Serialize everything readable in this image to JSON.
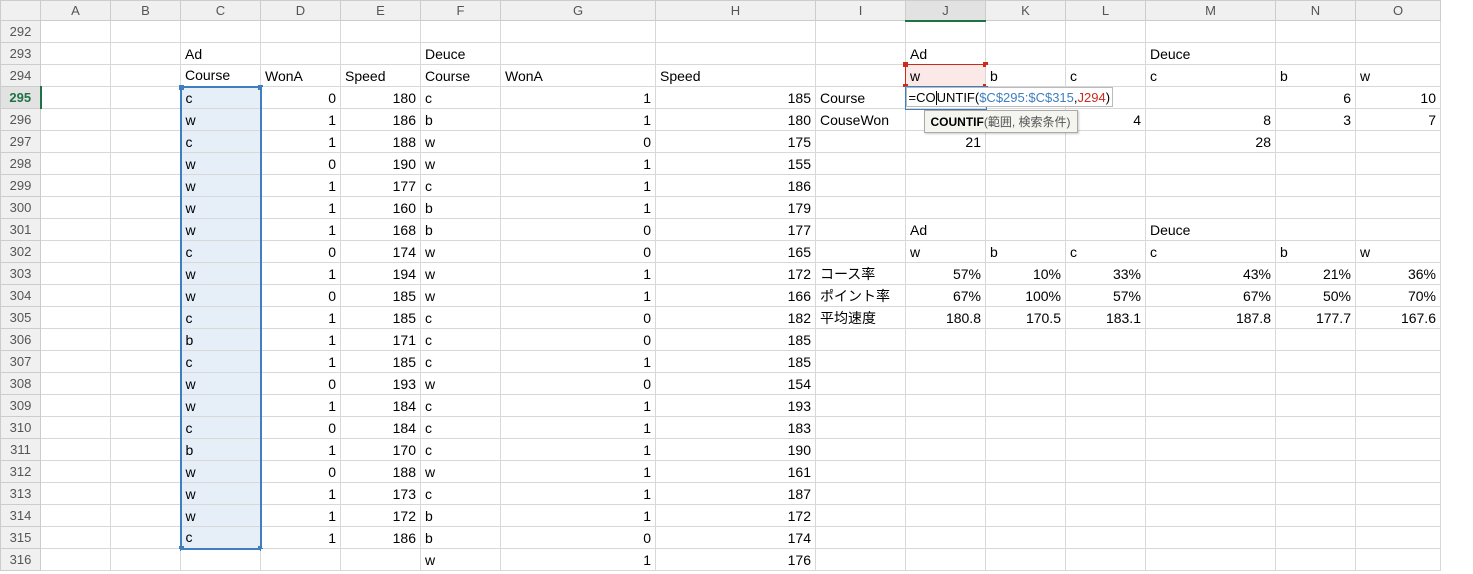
{
  "columns": [
    "A",
    "B",
    "C",
    "D",
    "E",
    "F",
    "G",
    "H",
    "I",
    "J",
    "K",
    "L",
    "M",
    "N",
    "O"
  ],
  "rows": [
    292,
    293,
    294,
    295,
    296,
    297,
    298,
    299,
    300,
    301,
    302,
    303,
    304,
    305,
    306,
    307,
    308,
    309,
    310,
    311,
    312,
    313,
    314,
    315,
    316
  ],
  "active_row": 295,
  "active_col": "J",
  "selected_range": {
    "col": "C",
    "from": 295,
    "to": 315
  },
  "ref_red_cell": {
    "col": "J",
    "row": 294
  },
  "formula_text": "=COUNTIF($C$295:$C$315,J294)",
  "formula_parts": {
    "prefix": "=CO",
    "mid1": "U",
    "mid2": "NTIF(",
    "range": "$C$295:$C$315",
    "comma": ",",
    "ref": "J294",
    "close": ")"
  },
  "tooltip_fn": "COUNTIF",
  "tooltip_args": "(範囲, 検索条件)",
  "cells": {
    "293": {
      "C": {
        "t": "Ad"
      },
      "F": {
        "t": "Deuce"
      },
      "J": {
        "t": "Ad"
      },
      "M": {
        "t": "Deuce"
      }
    },
    "294": {
      "C": {
        "t": "Course"
      },
      "D": {
        "t": "WonA"
      },
      "E": {
        "t": "Speed"
      },
      "F": {
        "t": "Course"
      },
      "G": {
        "t": "WonA"
      },
      "H": {
        "t": "Speed"
      },
      "J": {
        "t": "w"
      },
      "K": {
        "t": "b"
      },
      "L": {
        "t": "c"
      },
      "M": {
        "t": "c"
      },
      "N": {
        "t": "b"
      },
      "O": {
        "t": "w"
      }
    },
    "295": {
      "C": {
        "t": "c"
      },
      "D": {
        "n": "0"
      },
      "E": {
        "n": "180"
      },
      "F": {
        "t": "c"
      },
      "G": {
        "n": "1"
      },
      "H": {
        "n": "185"
      },
      "I": {
        "t": "Course"
      },
      "N": {
        "n": "6"
      },
      "O": {
        "n": "10"
      }
    },
    "296": {
      "C": {
        "t": "w"
      },
      "D": {
        "n": "1"
      },
      "E": {
        "n": "186"
      },
      "F": {
        "t": "b"
      },
      "G": {
        "n": "1"
      },
      "H": {
        "n": "180"
      },
      "I": {
        "t": "CouseWon"
      },
      "L": {
        "n": "4"
      },
      "M": {
        "n": "8"
      },
      "N": {
        "n": "3"
      },
      "O": {
        "n": "7"
      }
    },
    "297": {
      "C": {
        "t": "c"
      },
      "D": {
        "n": "1"
      },
      "E": {
        "n": "188"
      },
      "F": {
        "t": "w"
      },
      "G": {
        "n": "0"
      },
      "H": {
        "n": "175"
      },
      "J": {
        "n": "21"
      },
      "M": {
        "n": "28"
      }
    },
    "298": {
      "C": {
        "t": "w"
      },
      "D": {
        "n": "0"
      },
      "E": {
        "n": "190"
      },
      "F": {
        "t": "w"
      },
      "G": {
        "n": "1"
      },
      "H": {
        "n": "155"
      }
    },
    "299": {
      "C": {
        "t": "w"
      },
      "D": {
        "n": "1"
      },
      "E": {
        "n": "177"
      },
      "F": {
        "t": "c"
      },
      "G": {
        "n": "1"
      },
      "H": {
        "n": "186"
      }
    },
    "300": {
      "C": {
        "t": "w"
      },
      "D": {
        "n": "1"
      },
      "E": {
        "n": "160"
      },
      "F": {
        "t": "b"
      },
      "G": {
        "n": "1"
      },
      "H": {
        "n": "179"
      }
    },
    "301": {
      "C": {
        "t": "w"
      },
      "D": {
        "n": "1"
      },
      "E": {
        "n": "168"
      },
      "F": {
        "t": "b"
      },
      "G": {
        "n": "0"
      },
      "H": {
        "n": "177"
      },
      "J": {
        "t": "Ad"
      },
      "M": {
        "t": "Deuce"
      }
    },
    "302": {
      "C": {
        "t": "c"
      },
      "D": {
        "n": "0"
      },
      "E": {
        "n": "174"
      },
      "F": {
        "t": "w"
      },
      "G": {
        "n": "0"
      },
      "H": {
        "n": "165"
      },
      "J": {
        "t": "w"
      },
      "K": {
        "t": "b"
      },
      "L": {
        "t": "c"
      },
      "M": {
        "t": "c"
      },
      "N": {
        "t": "b"
      },
      "O": {
        "t": "w"
      }
    },
    "303": {
      "C": {
        "t": "w"
      },
      "D": {
        "n": "1"
      },
      "E": {
        "n": "194"
      },
      "F": {
        "t": "w"
      },
      "G": {
        "n": "1"
      },
      "H": {
        "n": "172"
      },
      "I": {
        "t": "コース率"
      },
      "J": {
        "n": "57%"
      },
      "K": {
        "n": "10%"
      },
      "L": {
        "n": "33%"
      },
      "M": {
        "n": "43%"
      },
      "N": {
        "n": "21%"
      },
      "O": {
        "n": "36%"
      }
    },
    "304": {
      "C": {
        "t": "w"
      },
      "D": {
        "n": "0"
      },
      "E": {
        "n": "185"
      },
      "F": {
        "t": "w"
      },
      "G": {
        "n": "1"
      },
      "H": {
        "n": "166"
      },
      "I": {
        "t": "ポイント率"
      },
      "J": {
        "n": "67%"
      },
      "K": {
        "n": "100%"
      },
      "L": {
        "n": "57%"
      },
      "M": {
        "n": "67%"
      },
      "N": {
        "n": "50%"
      },
      "O": {
        "n": "70%"
      }
    },
    "305": {
      "C": {
        "t": "c"
      },
      "D": {
        "n": "1"
      },
      "E": {
        "n": "185"
      },
      "F": {
        "t": "c"
      },
      "G": {
        "n": "0"
      },
      "H": {
        "n": "182"
      },
      "I": {
        "t": "平均速度"
      },
      "J": {
        "n": "180.8"
      },
      "K": {
        "n": "170.5"
      },
      "L": {
        "n": "183.1"
      },
      "M": {
        "n": "187.8"
      },
      "N": {
        "n": "177.7"
      },
      "O": {
        "n": "167.6"
      }
    },
    "306": {
      "C": {
        "t": "b"
      },
      "D": {
        "n": "1"
      },
      "E": {
        "n": "171"
      },
      "F": {
        "t": "c"
      },
      "G": {
        "n": "0"
      },
      "H": {
        "n": "185"
      }
    },
    "307": {
      "C": {
        "t": "c"
      },
      "D": {
        "n": "1"
      },
      "E": {
        "n": "185"
      },
      "F": {
        "t": "c"
      },
      "G": {
        "n": "1"
      },
      "H": {
        "n": "185"
      }
    },
    "308": {
      "C": {
        "t": "w"
      },
      "D": {
        "n": "0"
      },
      "E": {
        "n": "193"
      },
      "F": {
        "t": "w"
      },
      "G": {
        "n": "0"
      },
      "H": {
        "n": "154"
      }
    },
    "309": {
      "C": {
        "t": "w"
      },
      "D": {
        "n": "1"
      },
      "E": {
        "n": "184"
      },
      "F": {
        "t": "c"
      },
      "G": {
        "n": "1"
      },
      "H": {
        "n": "193"
      }
    },
    "310": {
      "C": {
        "t": "c"
      },
      "D": {
        "n": "0"
      },
      "E": {
        "n": "184"
      },
      "F": {
        "t": "c"
      },
      "G": {
        "n": "1"
      },
      "H": {
        "n": "183"
      }
    },
    "311": {
      "C": {
        "t": "b"
      },
      "D": {
        "n": "1"
      },
      "E": {
        "n": "170"
      },
      "F": {
        "t": "c"
      },
      "G": {
        "n": "1"
      },
      "H": {
        "n": "190"
      }
    },
    "312": {
      "C": {
        "t": "w"
      },
      "D": {
        "n": "0"
      },
      "E": {
        "n": "188"
      },
      "F": {
        "t": "w"
      },
      "G": {
        "n": "1"
      },
      "H": {
        "n": "161"
      }
    },
    "313": {
      "C": {
        "t": "w"
      },
      "D": {
        "n": "1"
      },
      "E": {
        "n": "173"
      },
      "F": {
        "t": "c"
      },
      "G": {
        "n": "1"
      },
      "H": {
        "n": "187"
      }
    },
    "314": {
      "C": {
        "t": "w"
      },
      "D": {
        "n": "1"
      },
      "E": {
        "n": "172"
      },
      "F": {
        "t": "b"
      },
      "G": {
        "n": "1"
      },
      "H": {
        "n": "172"
      }
    },
    "315": {
      "C": {
        "t": "c"
      },
      "D": {
        "n": "1"
      },
      "E": {
        "n": "186"
      },
      "F": {
        "t": "b"
      },
      "G": {
        "n": "0"
      },
      "H": {
        "n": "174"
      }
    },
    "316": {
      "F": {
        "t": "w"
      },
      "G": {
        "n": "1"
      },
      "H": {
        "n": "176"
      }
    }
  }
}
